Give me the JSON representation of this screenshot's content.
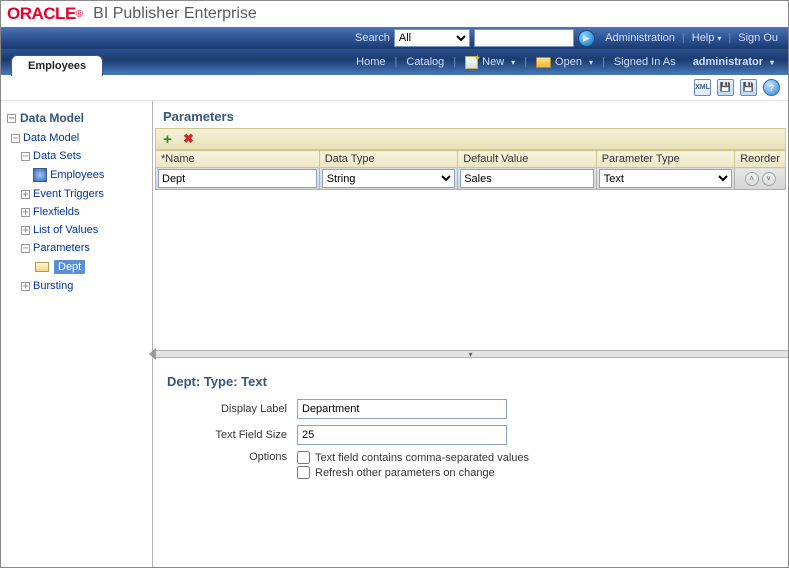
{
  "brand": {
    "logo": "ORACLE",
    "reg": "®",
    "title": "BI Publisher Enterprise"
  },
  "header": {
    "search_label": "Search",
    "scope_options": [
      "All"
    ],
    "scope_value": "All",
    "search_value": "",
    "admin": "Administration",
    "help": "Help",
    "signout": "Sign Ou"
  },
  "tab": {
    "label": "Employees"
  },
  "menu": {
    "home": "Home",
    "catalog": "Catalog",
    "new": "New",
    "open": "Open",
    "signed_in": "Signed In As",
    "user": "administrator"
  },
  "toolbar": {
    "xml": "XML"
  },
  "sidebar": {
    "header": "Data Model",
    "root": "Data Model",
    "data_sets": "Data Sets",
    "data_set_item": "Employees",
    "event_triggers": "Event Triggers",
    "flexfields": "Flexfields",
    "lov": "List of Values",
    "parameters": "Parameters",
    "param_item": "Dept",
    "bursting": "Bursting"
  },
  "main": {
    "title": "Parameters",
    "columns": {
      "name": "*Name",
      "dtype": "Data Type",
      "defval": "Default Value",
      "ptype": "Parameter Type",
      "reorder": "Reorder"
    },
    "row": {
      "name": "Dept",
      "dtype": "String",
      "defval": "Sales",
      "ptype": "Text"
    }
  },
  "detail": {
    "title": "Dept: Type: Text",
    "display_label_lbl": "Display Label",
    "display_label_val": "Department",
    "text_size_lbl": "Text Field Size",
    "text_size_val": "25",
    "options_lbl": "Options",
    "opt1": "Text field contains comma-separated values",
    "opt2": "Refresh other parameters on change"
  }
}
